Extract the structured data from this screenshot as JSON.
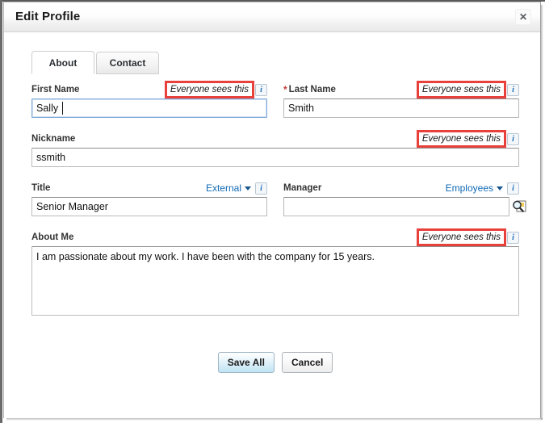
{
  "window": {
    "title": "Edit Profile",
    "close_label": "✕"
  },
  "tabs": [
    {
      "label": "About",
      "active": true
    },
    {
      "label": "Contact",
      "active": false
    }
  ],
  "fields": {
    "first_name": {
      "label": "First Name",
      "required": false,
      "visibility": "Everyone sees this",
      "visibility_highlighted": true,
      "info_icon": "i",
      "value": "Sally",
      "focused": true
    },
    "last_name": {
      "label": "Last Name",
      "required": true,
      "required_marker": "*",
      "visibility": "Everyone sees this",
      "visibility_highlighted": true,
      "info_icon": "i",
      "value": "Smith",
      "focused": false
    },
    "nickname": {
      "label": "Nickname",
      "required": false,
      "visibility": "Everyone sees this",
      "visibility_highlighted": true,
      "info_icon": "i",
      "value": "ssmith",
      "focused": false
    },
    "title": {
      "label": "Title",
      "required": false,
      "picker": "External",
      "info_icon": "i",
      "value": "Senior Manager",
      "focused": false
    },
    "manager": {
      "label": "Manager",
      "required": false,
      "picker": "Employees",
      "info_icon": "i",
      "value": "",
      "placeholder": "",
      "lookup_icon": "lookup-magnifier-icon",
      "focused": false
    },
    "about_me": {
      "label": "About Me",
      "required": false,
      "visibility": "Everyone sees this",
      "visibility_highlighted": true,
      "info_icon": "i",
      "value": "I am passionate about my work. I have been with the company for 15 years."
    }
  },
  "buttons": {
    "save": "Save All",
    "cancel": "Cancel"
  },
  "colors": {
    "link": "#126ab5",
    "required": "#c23934",
    "highlight_box": "#e8403a",
    "primary_button": "#bfe4f4"
  }
}
